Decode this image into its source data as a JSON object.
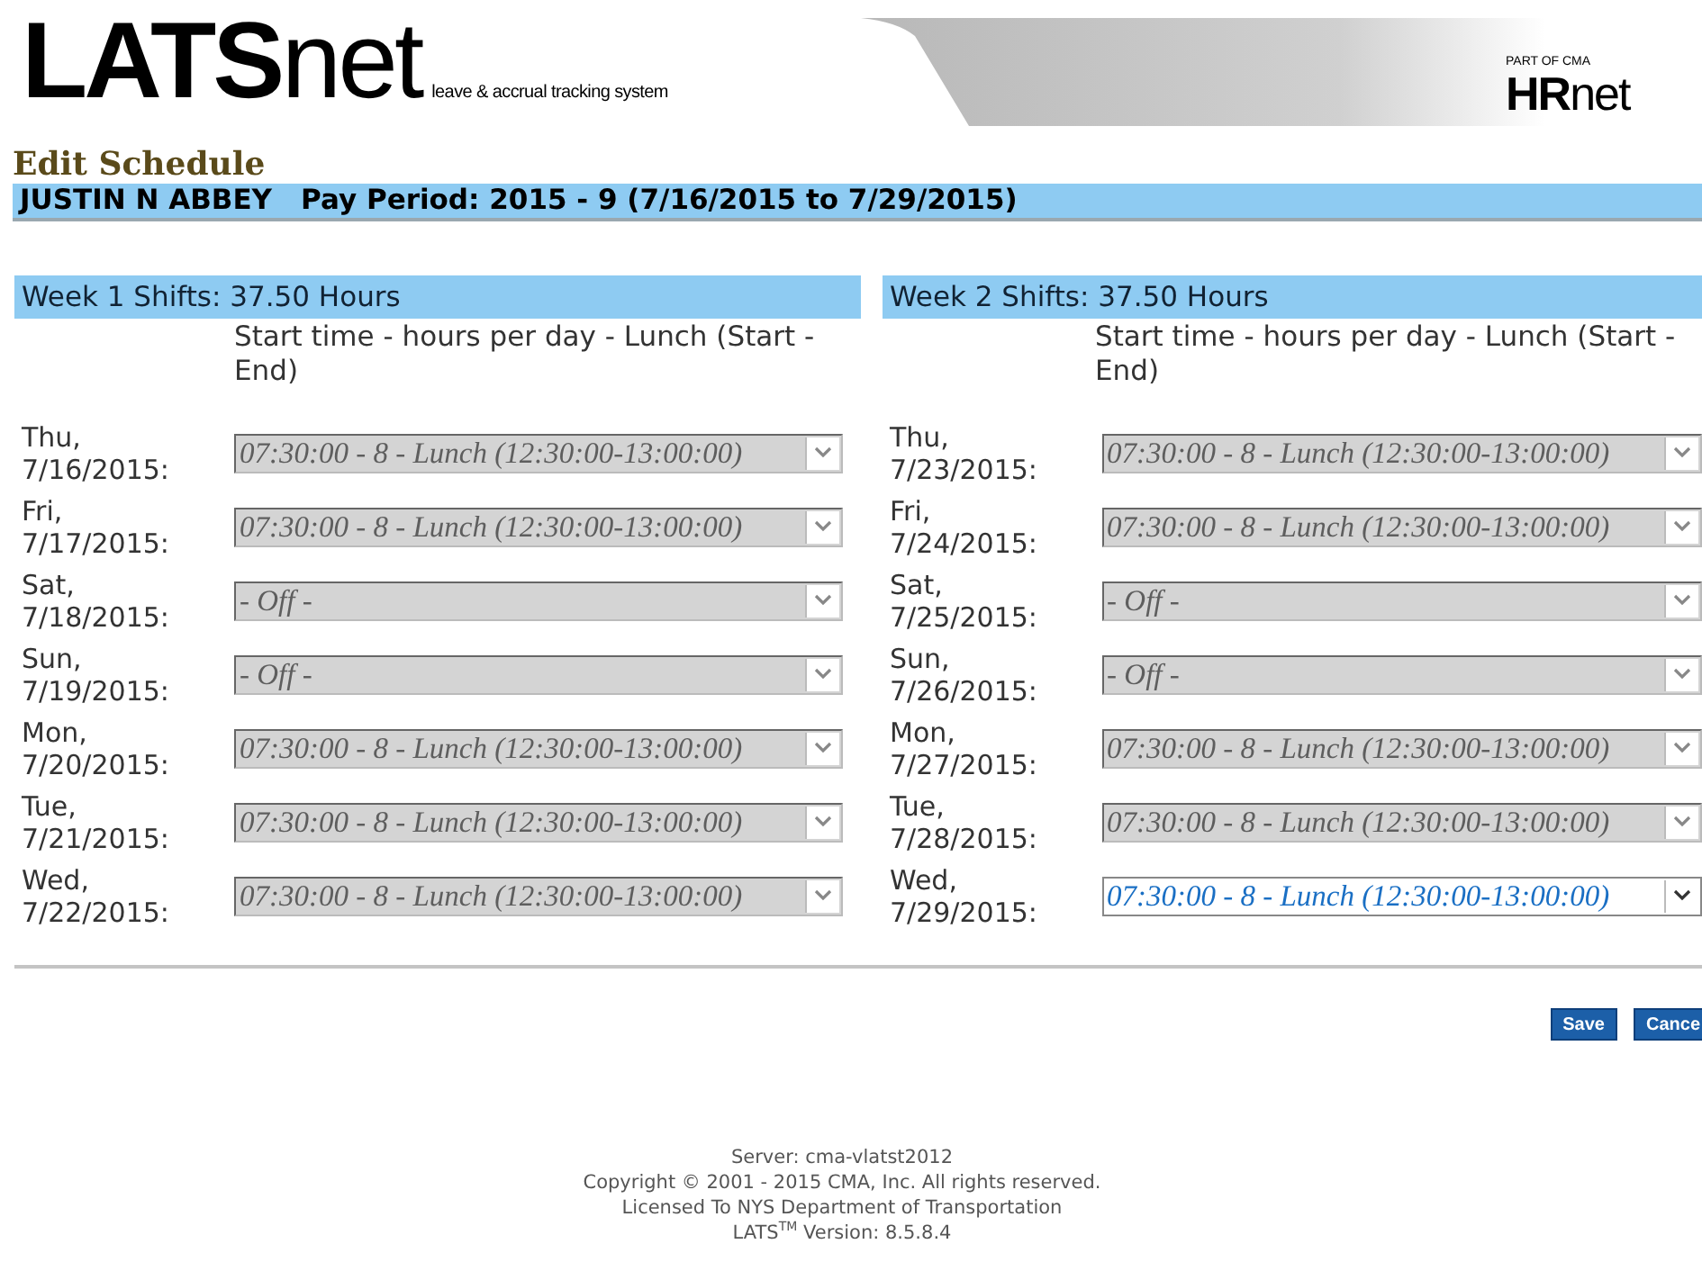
{
  "header": {
    "logo": "**LATS**net",
    "tagline": "leave & accrual tracking system",
    "partner_prefix": "PART OF CMA",
    "partner_logo": "**HR**net"
  },
  "page_title": "Edit Schedule",
  "employee_bar": {
    "name": "JUSTIN N ABBEY",
    "pay_period": "Pay Period: 2015 - 9 (7/16/2015 to 7/29/2015)"
  },
  "weeks": [
    {
      "title": "Week 1 Shifts: 37.50 Hours",
      "column_heading": "Start time - hours per day - Lunch (Start - End)",
      "rows": [
        {
          "date": "Thu, 7/16/2015:",
          "value": "07:30:00 - 8 - Lunch (12:30:00-13:00:00)",
          "disabled": true
        },
        {
          "date": "Fri, 7/17/2015:",
          "value": "07:30:00 - 8 - Lunch (12:30:00-13:00:00)",
          "disabled": true
        },
        {
          "date": "Sat, 7/18/2015:",
          "value": "- Off -",
          "disabled": true
        },
        {
          "date": "Sun, 7/19/2015:",
          "value": "- Off -",
          "disabled": true
        },
        {
          "date": "Mon, 7/20/2015:",
          "value": "07:30:00 - 8 - Lunch (12:30:00-13:00:00)",
          "disabled": true
        },
        {
          "date": "Tue, 7/21/2015:",
          "value": "07:30:00 - 8 - Lunch (12:30:00-13:00:00)",
          "disabled": true
        },
        {
          "date": "Wed, 7/22/2015:",
          "value": "07:30:00 - 8 - Lunch (12:30:00-13:00:00)",
          "disabled": true
        }
      ]
    },
    {
      "title": "Week 2 Shifts: 37.50 Hours",
      "column_heading": "Start time - hours per day - Lunch (Start - End)",
      "rows": [
        {
          "date": "Thu, 7/23/2015:",
          "value": "07:30:00 - 8 - Lunch (12:30:00-13:00:00)",
          "disabled": true
        },
        {
          "date": "Fri, 7/24/2015:",
          "value": "07:30:00 - 8 - Lunch (12:30:00-13:00:00)",
          "disabled": true
        },
        {
          "date": "Sat, 7/25/2015:",
          "value": "- Off -",
          "disabled": true
        },
        {
          "date": "Sun, 7/26/2015:",
          "value": "- Off -",
          "disabled": true
        },
        {
          "date": "Mon, 7/27/2015:",
          "value": "07:30:00 - 8 - Lunch (12:30:00-13:00:00)",
          "disabled": true
        },
        {
          "date": "Tue, 7/28/2015:",
          "value": "07:30:00 - 8 - Lunch (12:30:00-13:00:00)",
          "disabled": true
        },
        {
          "date": "Wed, 7/29/2015:",
          "value": "07:30:00 - 8 - Lunch (12:30:00-13:00:00)",
          "disabled": false
        }
      ]
    }
  ],
  "buttons": [
    "Save",
    "Cance"
  ],
  "footer": [
    "Server:  cma-vlatst2012",
    "Copyright © 2001 - 2015 CMA, Inc. All rights reserved.",
    "Licensed To NYS Department of Transportation",
    "LATS$^{TM}$ Version: 8.5.8.4"
  ]
}
